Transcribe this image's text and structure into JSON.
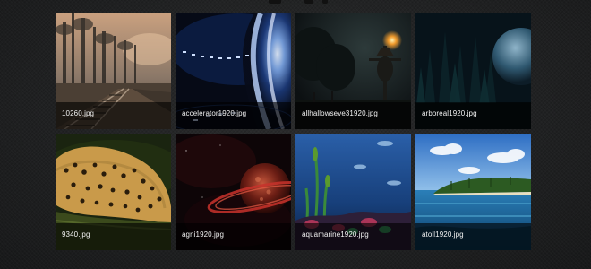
{
  "gallery": {
    "items": [
      {
        "filename": "10260.jpg",
        "theme": "misty-forest-railroad"
      },
      {
        "filename": "accelerator1920.jpg",
        "theme": "blue-light-tunnel"
      },
      {
        "filename": "allhallowseve31920.jpg",
        "theme": "scarecrow-night"
      },
      {
        "filename": "arboreal1920.jpg",
        "theme": "forest-with-planet"
      },
      {
        "filename": "9340.jpg",
        "theme": "sleeping-leopard"
      },
      {
        "filename": "agni1920.jpg",
        "theme": "red-ringed-planet"
      },
      {
        "filename": "aquamarine1920.jpg",
        "theme": "underwater-reef"
      },
      {
        "filename": "atoll1920.jpg",
        "theme": "tropical-atoll"
      }
    ]
  }
}
